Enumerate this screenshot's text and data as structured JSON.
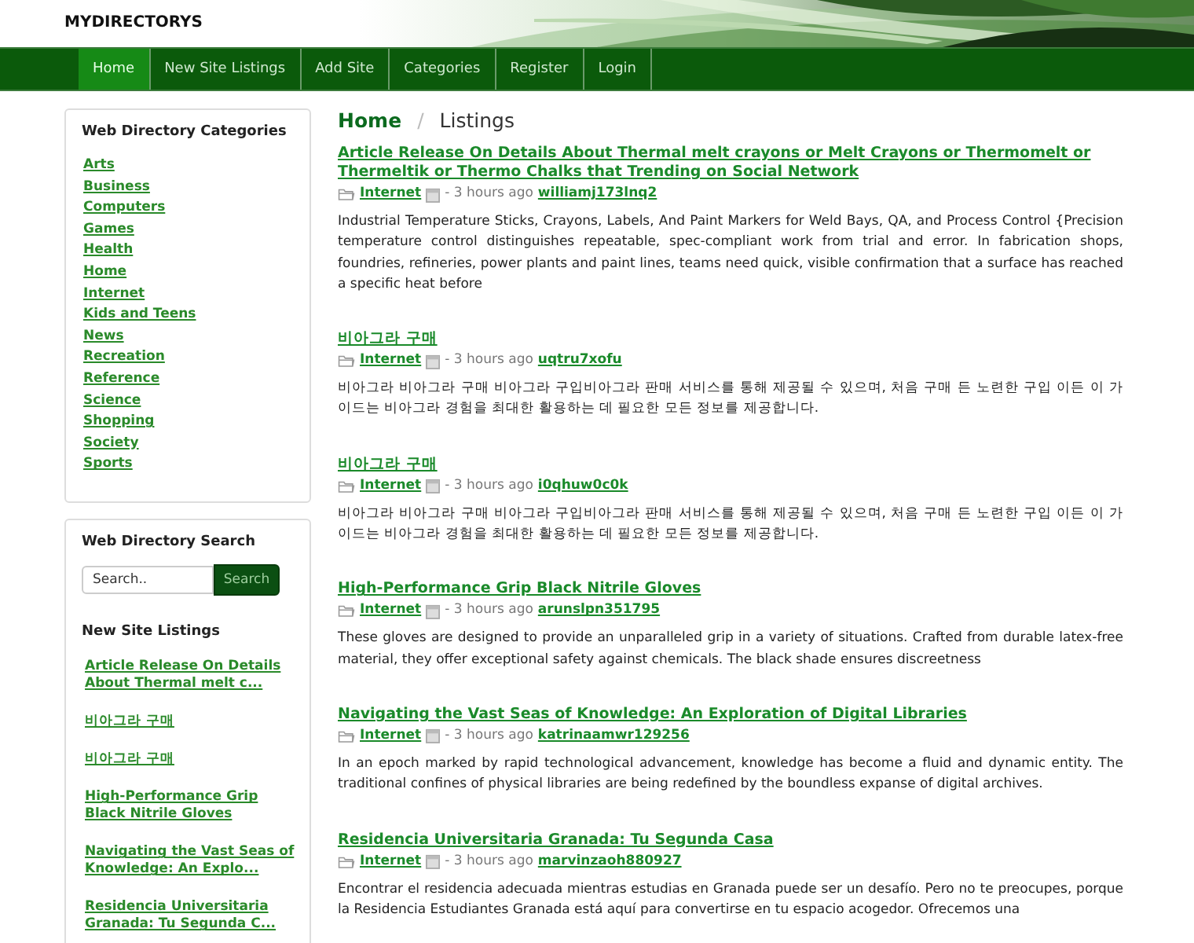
{
  "site": {
    "logo": "MYDIRECTORYS"
  },
  "nav": [
    {
      "label": "Home",
      "selected": true
    },
    {
      "label": "New Site Listings",
      "selected": false
    },
    {
      "label": "Add Site",
      "selected": false
    },
    {
      "label": "Categories",
      "selected": false
    },
    {
      "label": "Register",
      "selected": false
    },
    {
      "label": "Login",
      "selected": false
    }
  ],
  "sidebar": {
    "categories": {
      "title": "Web Directory Categories",
      "items": [
        "Arts",
        "Business",
        "Computers",
        "Games",
        "Health",
        "Home",
        "Internet",
        "Kids and Teens",
        "News",
        "Recreation",
        "Reference",
        "Science",
        "Shopping",
        "Society",
        "Sports"
      ]
    },
    "search": {
      "title": "Web Directory Search",
      "placeholder": "Search..",
      "button": "Search"
    },
    "new_listings": {
      "title": "New Site Listings",
      "items": [
        "Article Release On Details About Thermal melt c...",
        "비아그라 구매",
        "비아그라 구매",
        "High-Performance Grip Black Nitrile Gloves",
        "Navigating the Vast Seas of Knowledge: An Explo...",
        "Residencia Universitaria Granada: Tu Segunda C..."
      ]
    }
  },
  "breadcrumb": {
    "separator": "/",
    "items": [
      {
        "label": "Home",
        "kind": "link"
      },
      {
        "label": "Listings",
        "kind": "current"
      }
    ]
  },
  "listings": [
    {
      "title": "Article Release On Details About Thermal melt crayons or Melt Crayons or Thermomelt or Thermeltik or Thermo Chalks that Trending on Social Network",
      "category": "Internet",
      "time": "- 3 hours ago",
      "user": "williamj173lnq2",
      "description": "Industrial Temperature Sticks, Crayons, Labels, And Paint Markers for Weld Bays, QA, and Process Control {Precision temperature control distinguishes repeatable, spec-compliant work from trial and error. In fabrication shops, foundries, refineries, power plants and paint lines, teams need quick, visible confirmation that a surface has reached a specific heat before"
    },
    {
      "title": "비아그라 구매",
      "category": "Internet",
      "time": "- 3 hours ago",
      "user": "uqtru7xofu",
      "description": "비아그라 비아그라 구매 비아그라 구입비아그라 판매 서비스를 통해 제공될 수 있으며, 처음 구매 든 노련한 구입 이든 이 가이드는 비아그라 경험을 최대한 활용하는 데 필요한 모든 정보를 제공합니다."
    },
    {
      "title": "비아그라 구매",
      "category": "Internet",
      "time": "- 3 hours ago",
      "user": "i0qhuw0c0k",
      "description": "비아그라 비아그라 구매 비아그라 구입비아그라 판매 서비스를 통해 제공될 수 있으며, 처음 구매 든 노련한 구입 이든 이 가이드는 비아그라 경험을 최대한 활용하는 데 필요한 모든 정보를 제공합니다."
    },
    {
      "title": "High-Performance Grip Black Nitrile Gloves",
      "category": "Internet",
      "time": "- 3 hours ago",
      "user": "arunslpn351795",
      "description": "These gloves are designed to provide an unparalleled grip in a variety of situations. Crafted from durable latex-free material, they offer exceptional safety against chemicals. The black shade ensures discreetness"
    },
    {
      "title": "Navigating the Vast Seas of Knowledge: An Exploration of Digital Libraries",
      "category": "Internet",
      "time": "- 3 hours ago",
      "user": "katrinaamwr129256",
      "description": "In an epoch marked by rapid technological advancement, knowledge has become a fluid and dynamic entity. The traditional confines of physical libraries are being redefined by the boundless expanse of digital archives."
    },
    {
      "title": "Residencia Universitaria Granada: Tu Segunda Casa",
      "category": "Internet",
      "time": "- 3 hours ago",
      "user": "marvinzaoh880927",
      "description": "Encontrar el residencia adecuada mientras estudias en Granada puede ser un desafío. Pero no te preocupes, porque la Residencia Estudiantes Granada está aquí para convertirse en tu espacio acogedor. Ofrecemos una"
    }
  ]
}
